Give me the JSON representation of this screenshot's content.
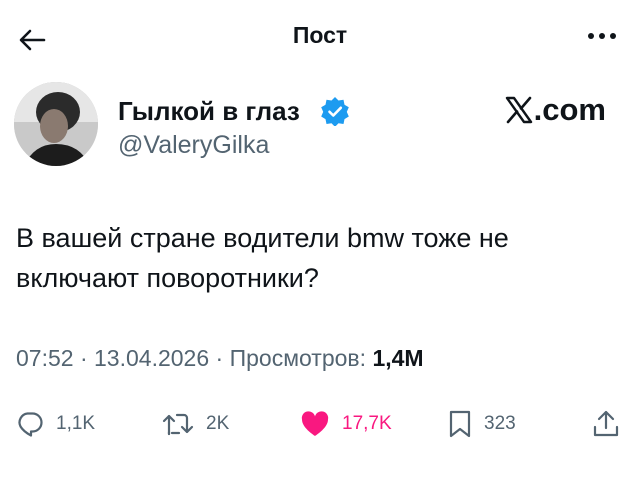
{
  "header": {
    "title": "Пост",
    "back_icon": "arrow-left-icon",
    "more_icon": "more-horizontal-icon"
  },
  "author": {
    "display_name": "Гылкой в глаз",
    "handle": "@ValeryGilka",
    "verified": true,
    "avatar_icon": "avatar"
  },
  "brand": {
    "logo": "x-logo-icon",
    "suffix": ".com"
  },
  "tweet": {
    "text": "В вашей стране водители bmw тоже не включают поворотники?"
  },
  "meta": {
    "time": "07:52",
    "separator1": " · ",
    "date": "13.04.2026",
    "separator2": " · ",
    "views_label": "Просмотров: ",
    "views_count": "1,4M"
  },
  "actions": {
    "reply_count": "1,1K",
    "retweet_count": "2K",
    "like_count": "17,7K",
    "bookmark_count": "323"
  },
  "colors": {
    "text": "#0f1419",
    "secondary": "#536471",
    "verified": "#1d9bf0",
    "like": "#f91880"
  }
}
